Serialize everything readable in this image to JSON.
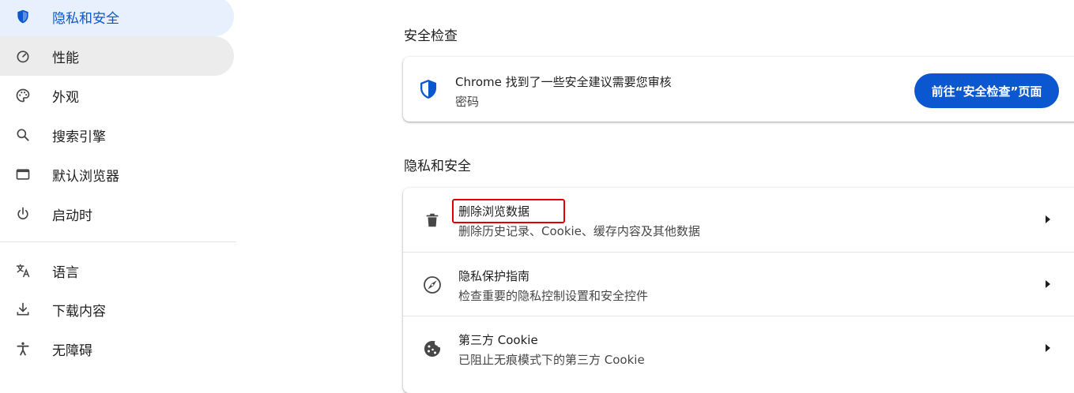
{
  "sidebar": {
    "items": [
      {
        "label": "隐私和安全",
        "icon": "shield-icon"
      },
      {
        "label": "性能",
        "icon": "speedometer-icon"
      },
      {
        "label": "外观",
        "icon": "palette-icon"
      },
      {
        "label": "搜索引擎",
        "icon": "search-icon"
      },
      {
        "label": "默认浏览器",
        "icon": "browser-window-icon"
      },
      {
        "label": "启动时",
        "icon": "power-icon"
      },
      {
        "label": "语言",
        "icon": "translate-icon"
      },
      {
        "label": "下载内容",
        "icon": "download-icon"
      },
      {
        "label": "无障碍",
        "icon": "accessibility-icon"
      }
    ]
  },
  "safety_check": {
    "title": "安全检查",
    "message": "Chrome 找到了一些安全建议需要您审核",
    "detail": "密码",
    "button_label": "前往“安全检查”页面"
  },
  "privacy": {
    "title": "隐私和安全",
    "rows": [
      {
        "title": "删除浏览数据",
        "subtitle": "删除历史记录、Cookie、缓存内容及其他数据",
        "icon": "trash-icon"
      },
      {
        "title": "隐私保护指南",
        "subtitle": "检查重要的隐私控制设置和安全控件",
        "icon": "compass-icon"
      },
      {
        "title": "第三方 Cookie",
        "subtitle": "已阻止无痕模式下的第三方 Cookie",
        "icon": "cookie-icon"
      }
    ]
  },
  "colors": {
    "accent": "#0b57d0",
    "selected_bg": "#e8f0fe",
    "highlight": "#e00000"
  }
}
